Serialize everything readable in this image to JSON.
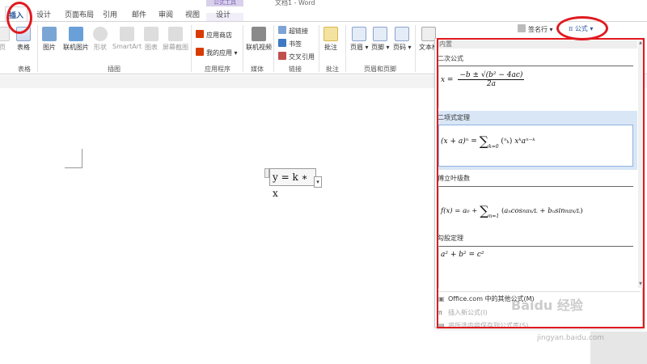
{
  "window": {
    "context_group_label": "公式工具",
    "title": "文档1 - Word"
  },
  "tabs": [
    {
      "label": "插入",
      "active": true
    },
    {
      "label": "设计"
    },
    {
      "label": "页面布局"
    },
    {
      "label": "引用"
    },
    {
      "label": "邮件"
    },
    {
      "label": "审阅"
    },
    {
      "label": "视图"
    },
    {
      "label": "设计",
      "contextual": true
    }
  ],
  "ribbon": {
    "pages_label": "页",
    "table_label": "表格",
    "table_group": "表格",
    "pictures": "图片",
    "online_pictures": "联机图片",
    "shapes": "形状",
    "smartart": "SmartArt",
    "chart": "图表",
    "screenshot": "屏幕截图",
    "illustrations_group": "插图",
    "store": "应用商店",
    "my_apps": "我的应用",
    "apps_group": "应用程序",
    "online_video": "联机视频",
    "media_group": "媒体",
    "hyperlink": "超链接",
    "bookmark": "书签",
    "cross_ref": "交叉引用",
    "links_group": "链接",
    "comment": "批注",
    "comments_group": "批注",
    "header": "页眉",
    "footer": "页脚",
    "page_number": "页码",
    "header_footer_group": "页眉和页脚",
    "textbox": "文本框",
    "signature_line": "签名行",
    "equation": "公式",
    "pi_symbol": "π"
  },
  "document": {
    "equation_text": "y = k ∗ x"
  },
  "gallery": {
    "header": "内置",
    "items": [
      {
        "name": "二次公式",
        "formula": "x = (−b ± √(b² − 4ac)) / 2a"
      },
      {
        "name": "二项式定理",
        "formula": "(x + a)ⁿ = Σₖ₌₀ⁿ (ⁿₖ) xᵏaⁿ⁻ᵏ"
      },
      {
        "name": "傅立叶级数",
        "formula": "f(x) = a₀ + Σₙ₌₁^∞ (aₙcos(nπx/L) + bₙsin(nπx/L))"
      },
      {
        "name": "勾股定理",
        "formula": "a² + b² = c²"
      }
    ],
    "menu": [
      {
        "label": "Office.com 中的其他公式(M)",
        "enabled": true
      },
      {
        "label": "插入新公式(I)",
        "enabled": false
      },
      {
        "label": "将所选内容保存到公式库(S)...",
        "enabled": false
      }
    ]
  },
  "watermark": {
    "brand": "Baidu 经验",
    "url": "jingyan.baidu.com"
  },
  "colors": {
    "accent": "#2b579a",
    "annotation": "#e0191f",
    "highlight": "#d9e6f6"
  }
}
